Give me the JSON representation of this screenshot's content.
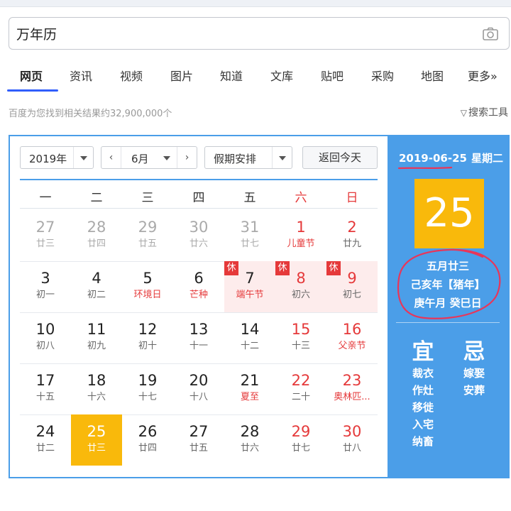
{
  "search": {
    "query": "万年历"
  },
  "nav": {
    "tabs": [
      {
        "label": "网页",
        "active": true
      },
      {
        "label": "资讯"
      },
      {
        "label": "视频"
      },
      {
        "label": "图片"
      },
      {
        "label": "知道"
      },
      {
        "label": "文库"
      },
      {
        "label": "贴吧"
      },
      {
        "label": "采购"
      },
      {
        "label": "地图"
      },
      {
        "label": "更多»"
      }
    ]
  },
  "results": {
    "count_text": "百度为您找到相关结果约32,900,000个",
    "tools_label": "搜索工具"
  },
  "calendar": {
    "year_select": "2019年",
    "prev_month": "‹",
    "month_select": "6月",
    "next_month": "›",
    "holiday_select": "假期安排",
    "today_button": "返回今天",
    "weekdays": [
      "一",
      "二",
      "三",
      "四",
      "五",
      "六",
      "日"
    ],
    "holiday_badge": "休",
    "weeks": [
      [
        {
          "d": "27",
          "l": "廿三",
          "other": true
        },
        {
          "d": "28",
          "l": "廿四",
          "other": true
        },
        {
          "d": "29",
          "l": "廿五",
          "other": true
        },
        {
          "d": "30",
          "l": "廿六",
          "other": true
        },
        {
          "d": "31",
          "l": "廿七",
          "other": true
        },
        {
          "d": "1",
          "l": "儿童节",
          "fest": true
        },
        {
          "d": "2",
          "l": "廿九"
        }
      ],
      [
        {
          "d": "3",
          "l": "初一"
        },
        {
          "d": "4",
          "l": "初二"
        },
        {
          "d": "5",
          "l": "环境日",
          "fest": true
        },
        {
          "d": "6",
          "l": "芒种",
          "fest": true
        },
        {
          "d": "7",
          "l": "端午节",
          "fest": true,
          "holiday": true
        },
        {
          "d": "8",
          "l": "初六",
          "holiday": true
        },
        {
          "d": "9",
          "l": "初七",
          "holiday": true
        }
      ],
      [
        {
          "d": "10",
          "l": "初八"
        },
        {
          "d": "11",
          "l": "初九"
        },
        {
          "d": "12",
          "l": "初十"
        },
        {
          "d": "13",
          "l": "十一"
        },
        {
          "d": "14",
          "l": "十二"
        },
        {
          "d": "15",
          "l": "十三"
        },
        {
          "d": "16",
          "l": "父亲节",
          "fest": true
        }
      ],
      [
        {
          "d": "17",
          "l": "十五"
        },
        {
          "d": "18",
          "l": "十六"
        },
        {
          "d": "19",
          "l": "十七"
        },
        {
          "d": "20",
          "l": "十八"
        },
        {
          "d": "21",
          "l": "夏至",
          "fest": true
        },
        {
          "d": "22",
          "l": "二十"
        },
        {
          "d": "23",
          "l": "奥林匹...",
          "fest": true
        }
      ],
      [
        {
          "d": "24",
          "l": "廿二"
        },
        {
          "d": "25",
          "l": "廿三",
          "today": true
        },
        {
          "d": "26",
          "l": "廿四"
        },
        {
          "d": "27",
          "l": "廿五"
        },
        {
          "d": "28",
          "l": "廿六"
        },
        {
          "d": "29",
          "l": "廿七"
        },
        {
          "d": "30",
          "l": "廿八"
        }
      ]
    ]
  },
  "side": {
    "date": "2019-06-25",
    "weekday": "星期二",
    "big_day": "25",
    "lunar_lines": [
      "五月廿三",
      "己亥年【猪年】",
      "庚午月 癸巳日"
    ],
    "yi_label": "宜",
    "ji_label": "忌",
    "yi_items": [
      "裁衣",
      "作灶",
      "移徙",
      "入宅",
      "纳畜"
    ],
    "ji_items": [
      "嫁娶",
      "安葬"
    ]
  },
  "colors": {
    "accent": "#4b9ee8",
    "today": "#f9b90b",
    "weekend": "#e5393a",
    "annotation": "#e8365a"
  }
}
